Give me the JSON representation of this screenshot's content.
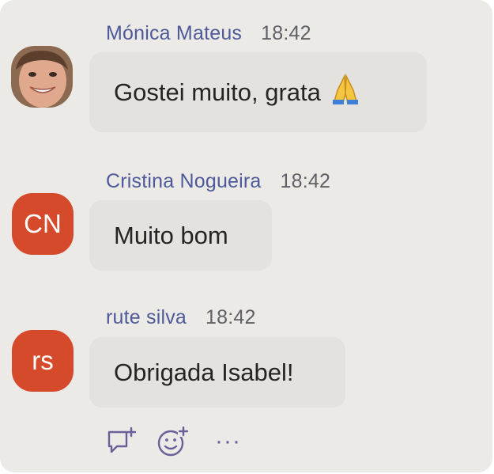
{
  "messages": [
    {
      "sender": "Mónica Mateus",
      "time": "18:42",
      "text": "Gostei muito, grata",
      "emoji_icon": "folded-hands-icon"
    },
    {
      "sender": "Cristina Nogueira",
      "time": "18:42",
      "text": "Muito bom",
      "avatar_initials": "CN",
      "avatar_color": "#d54a2a"
    },
    {
      "sender": "rute silva",
      "time": "18:42",
      "text": "Obrigada Isabel!",
      "avatar_initials": "rs",
      "avatar_color": "#d54a2a"
    }
  ],
  "actions": {
    "reply_icon": "reply-in-thread-icon",
    "react_icon": "add-reaction-icon",
    "more_icon": "more-options-icon",
    "more_glyph": "···"
  },
  "colors": {
    "background": "#eceae6",
    "bubble": "#e4e2df",
    "sender_name": "#4e5a9a",
    "accent_avatar": "#d54a2a"
  }
}
